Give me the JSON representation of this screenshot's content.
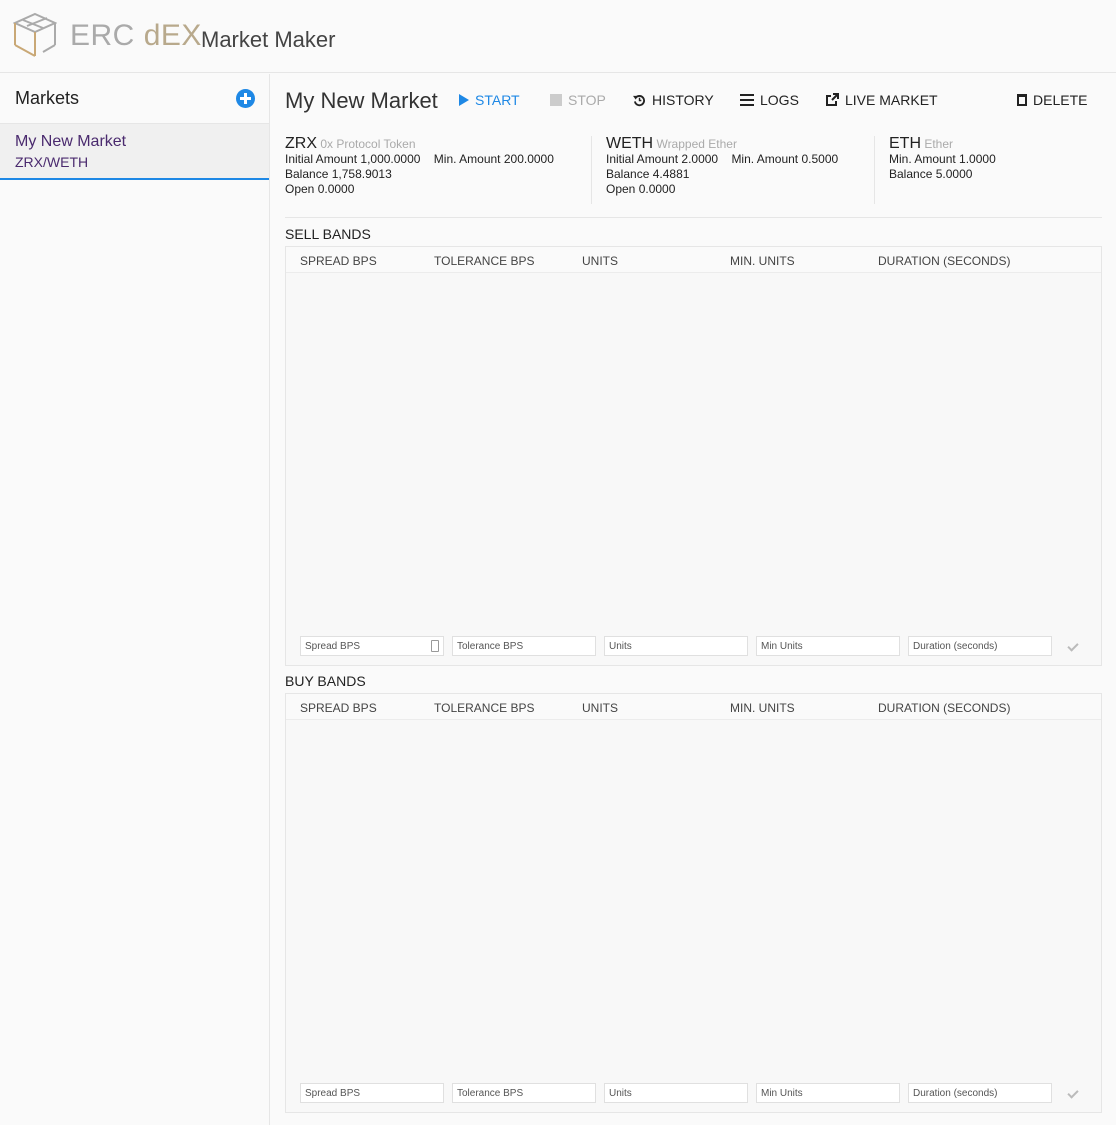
{
  "brand": {
    "erc": "ERC",
    "dex": "dEX",
    "subtitle": "Market Maker"
  },
  "sidebar": {
    "title": "Markets",
    "markets": [
      {
        "name": "My New Market",
        "pair": "ZRX/WETH"
      }
    ]
  },
  "main": {
    "title": "My New Market",
    "toolbar": {
      "start": "START",
      "stop": "STOP",
      "history": "HISTORY",
      "logs": "LOGS",
      "live_market": "LIVE MARKET",
      "delete": "DELETE"
    },
    "tokens": [
      {
        "symbol": "ZRX",
        "name": "0x Protocol Token",
        "initial_amount_label": "Initial Amount",
        "initial_amount": "1,000.0000",
        "min_amount_label": "Min. Amount",
        "min_amount": "200.0000",
        "balance_label": "Balance",
        "balance": "1,758.9013",
        "open_label": "Open",
        "open": "0.0000"
      },
      {
        "symbol": "WETH",
        "name": "Wrapped Ether",
        "initial_amount_label": "Initial Amount",
        "initial_amount": "2.0000",
        "min_amount_label": "Min. Amount",
        "min_amount": "0.5000",
        "balance_label": "Balance",
        "balance": "4.4881",
        "open_label": "Open",
        "open": "0.0000"
      },
      {
        "symbol": "ETH",
        "name": "Ether",
        "min_amount_label": "Min. Amount",
        "min_amount": "1.0000",
        "balance_label": "Balance",
        "balance": "5.0000"
      }
    ],
    "columns": [
      "SPREAD BPS",
      "TOLERANCE BPS",
      "UNITS",
      "MIN. UNITS",
      "DURATION (SECONDS)"
    ],
    "placeholders": [
      "Spread BPS",
      "Tolerance BPS",
      "Units",
      "Min Units",
      "Duration (seconds)"
    ],
    "sell_bands": {
      "title": "SELL BANDS"
    },
    "buy_bands": {
      "title": "BUY BANDS"
    }
  },
  "colors": {
    "accent": "#1e88e5",
    "market_text": "#4a2a6e",
    "brand_gold": "#b8a98c"
  }
}
